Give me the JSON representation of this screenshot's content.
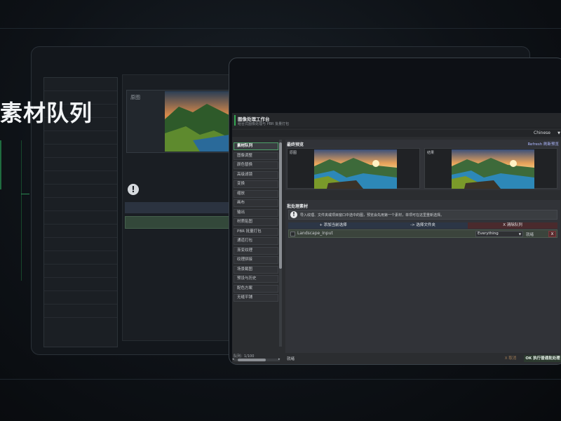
{
  "heading": "素材队列",
  "back_panel": {
    "thumb_label": "原图",
    "warn_icon": "!"
  },
  "app": {
    "title": "图像处理工作台",
    "subtitle": "组合式图像处理与 PBR 批量打包",
    "language": "Chinese",
    "sidebar": {
      "items": [
        {
          "label": "素材队列",
          "active": true
        },
        {
          "label": "图像调整",
          "active": false
        },
        {
          "label": "颜色替换",
          "active": false
        },
        {
          "label": "高级滤镜",
          "active": false
        },
        {
          "label": "变换",
          "active": false
        },
        {
          "label": "缩放",
          "active": false
        },
        {
          "label": "画布",
          "active": false
        },
        {
          "label": "输出",
          "active": false
        },
        {
          "label": "材质贴图",
          "active": false
        },
        {
          "label": "PBR 批量打包",
          "active": false
        },
        {
          "label": "通道打包",
          "active": false
        },
        {
          "label": "渐变纹理",
          "active": false
        },
        {
          "label": "纹理拼接",
          "active": false
        },
        {
          "label": "场景截图",
          "active": false
        },
        {
          "label": "预设与历史",
          "active": false
        },
        {
          "label": "配色方案",
          "active": false
        },
        {
          "label": "无缝平铺",
          "active": false
        }
      ],
      "count": "队列：1/100",
      "left_arrow": "◂",
      "right_arrow": "▸"
    },
    "preview": {
      "title": "最终预览",
      "refresh": "Refresh 刷新预览",
      "original_label": "原图",
      "result_label": "结果"
    },
    "batch": {
      "title": "批处理素材",
      "warn_icon": "!",
      "hint": "导入纹理、文件夹或项目窗口中选中的图，预览会先用第一个素材，单项可在这里重新选择。",
      "add_label": "+ 添加当前选择",
      "folder_label": "-> 选择文件夹",
      "clear_label": "X 清除队列",
      "file": {
        "name": "Landscape_Input",
        "mode": "Everything",
        "status": "就绪",
        "remove": "X"
      }
    },
    "status": {
      "text": "就绪",
      "cancel": "X 取消",
      "run": "OK 执行普通批处理"
    },
    "colors": {
      "accent_green": "#34a853",
      "danger": "#5a2b2e"
    }
  }
}
